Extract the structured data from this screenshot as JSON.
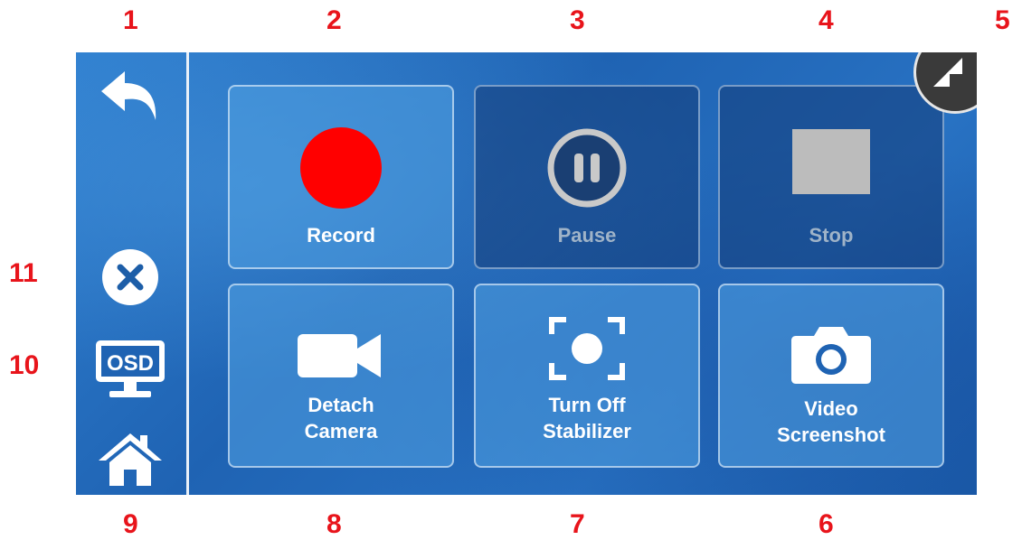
{
  "callouts": {
    "n1": "1",
    "n2": "2",
    "n3": "3",
    "n4": "4",
    "n5": "5",
    "n6": "6",
    "n7": "7",
    "n8": "8",
    "n9": "9",
    "n10": "10",
    "n11": "11"
  },
  "sidebar": {
    "osd_label": "OSD"
  },
  "buttons": {
    "record": "Record",
    "pause": "Pause",
    "stop": "Stop",
    "detach_line1": "Detach",
    "detach_line2": "Camera",
    "stabilizer_line1": "Turn Off",
    "stabilizer_line2": "Stabilizer",
    "screenshot_line1": "Video",
    "screenshot_line2": "Screenshot"
  },
  "colors": {
    "callout": "#e8141b",
    "record_dot": "#ff0000",
    "screen_bg": "#1f63b3"
  },
  "icons": {
    "back": "back-arrow-icon",
    "close": "close-icon",
    "osd": "osd-monitor-icon",
    "home": "home-icon",
    "record": "record-dot-icon",
    "pause": "pause-icon",
    "stop": "stop-square-icon",
    "detach": "video-camera-icon",
    "stabilizer": "stabilizer-focus-icon",
    "screenshot": "camera-icon",
    "corner": "collapse-arrows-icon"
  }
}
